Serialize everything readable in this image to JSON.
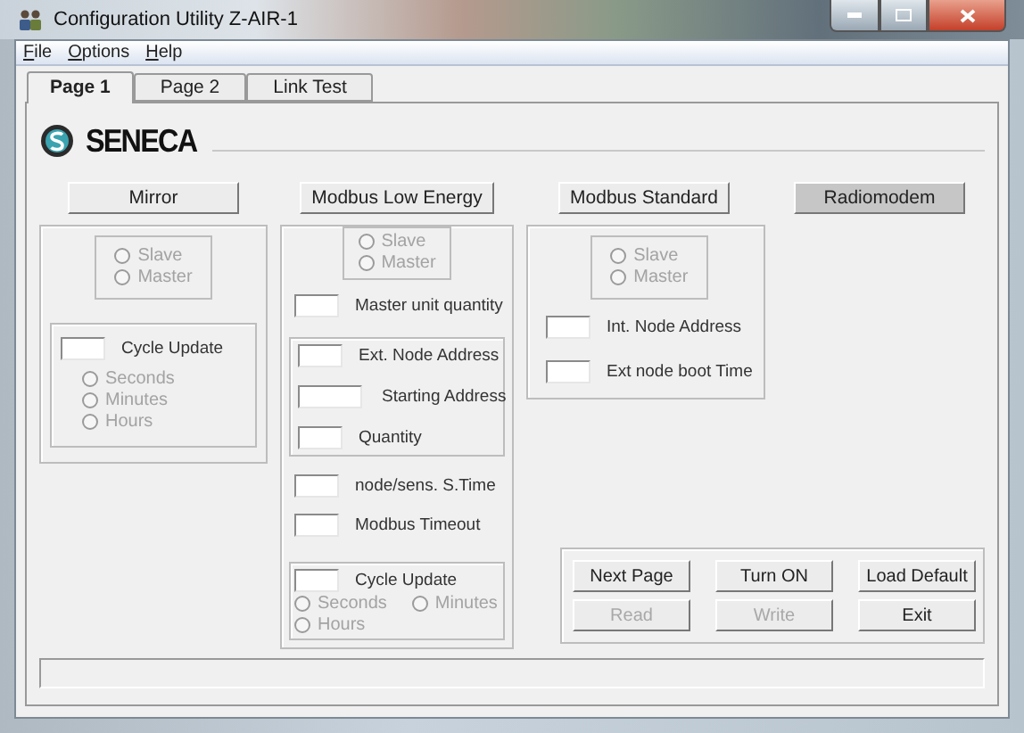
{
  "window": {
    "title": "Configuration Utility Z-AIR-1"
  },
  "menu": [
    "File",
    "Options",
    "Help"
  ],
  "tabs": [
    {
      "label": "Page 1",
      "selected": true
    },
    {
      "label": "Page 2",
      "selected": false
    },
    {
      "label": "Link Test",
      "selected": false
    }
  ],
  "logo": {
    "text": "SENECA"
  },
  "modes": [
    {
      "label": "Mirror",
      "selected": false
    },
    {
      "label": "Modbus Low Energy",
      "selected": false
    },
    {
      "label": "Modbus Standard",
      "selected": false
    },
    {
      "label": "Radiomodem",
      "selected": true
    }
  ],
  "mirror": {
    "role": [
      {
        "label": "Slave",
        "checked": false,
        "disabled": true
      },
      {
        "label": "Master",
        "checked": false,
        "disabled": true
      }
    ],
    "cycle": {
      "label": "Cycle Update",
      "units": [
        {
          "label": "Seconds",
          "checked": false,
          "disabled": true
        },
        {
          "label": "Minutes",
          "checked": false,
          "disabled": true
        },
        {
          "label": "Hours",
          "checked": false,
          "disabled": true
        }
      ]
    }
  },
  "modbus_low_energy": {
    "role": [
      {
        "label": "Slave",
        "checked": false,
        "disabled": true
      },
      {
        "label": "Master",
        "checked": false,
        "disabled": true
      }
    ],
    "master_unit_quantity": {
      "label": "Master unit quantity"
    },
    "external": [
      {
        "label": "Ext. Node Address",
        "kind": "short"
      },
      {
        "label": "Starting Address",
        "kind": "wide"
      },
      {
        "label": "Quantity",
        "kind": "short"
      }
    ],
    "fields": [
      {
        "label": "node/sens. S.Time"
      },
      {
        "label": "Modbus Timeout"
      }
    ],
    "cycle": {
      "label": "Cycle Update",
      "units": [
        {
          "label": "Seconds",
          "checked": false,
          "disabled": true
        },
        {
          "label": "Minutes",
          "checked": false,
          "disabled": true
        },
        {
          "label": "Hours",
          "checked": false,
          "disabled": true
        }
      ]
    }
  },
  "modbus_standard": {
    "role": [
      {
        "label": "Slave",
        "checked": false,
        "disabled": true
      },
      {
        "label": "Master",
        "checked": false,
        "disabled": true
      }
    ],
    "fields": [
      {
        "label": "Int. Node Address"
      },
      {
        "label": "Ext node boot Time"
      }
    ]
  },
  "actions": [
    {
      "label": "Next Page",
      "disabled": false
    },
    {
      "label": "Turn ON",
      "disabled": false
    },
    {
      "label": "Load Default",
      "disabled": false
    },
    {
      "label": "Read",
      "disabled": true
    },
    {
      "label": "Write",
      "disabled": true
    },
    {
      "label": "Exit",
      "disabled": false
    }
  ]
}
